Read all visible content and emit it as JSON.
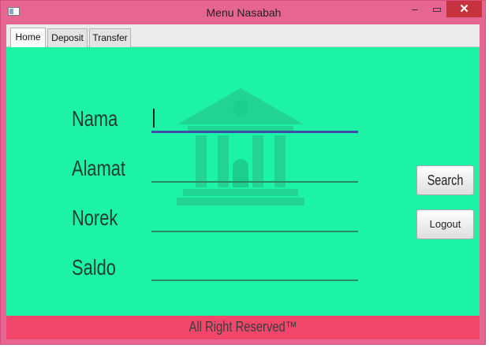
{
  "window": {
    "title": "Menu Nasabah",
    "minimize_glyph": "‒",
    "maximize_glyph": "▭",
    "close_glyph": "✕"
  },
  "tabs": [
    {
      "label": "Home",
      "active": true
    },
    {
      "label": "Deposit",
      "active": false
    },
    {
      "label": "Transfer",
      "active": false
    }
  ],
  "form": {
    "nama_label": "Nama",
    "nama_value": "",
    "alamat_label": "Alamat",
    "alamat_value": "",
    "norek_label": "Norek",
    "norek_value": "",
    "saldo_label": "Saldo",
    "saldo_value": ""
  },
  "buttons": {
    "search_label": "Search",
    "logout_label": "Logout"
  },
  "footer": {
    "text": "All Right Reserved™"
  },
  "colors": {
    "titlebar": "#e76592",
    "content_bg": "#1df3a4",
    "footer_bg": "#f2466a",
    "close_button": "#c7323f",
    "focus_underline": "#3b4fa8"
  },
  "icons": {
    "app": "window-app-icon",
    "watermark": "bank-building-icon"
  }
}
